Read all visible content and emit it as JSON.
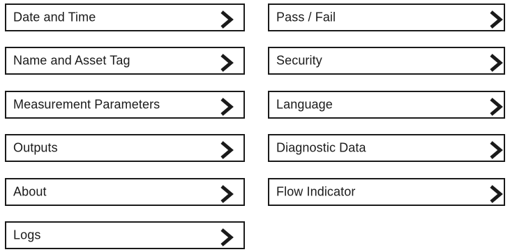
{
  "menu": {
    "left": [
      {
        "label": "Date and Time",
        "icon": "chevron-right-icon"
      },
      {
        "label": "Name and Asset Tag",
        "icon": "chevron-right-icon"
      },
      {
        "label": "Measurement Parameters",
        "icon": "chevron-right-icon"
      },
      {
        "label": "Outputs",
        "icon": "chevron-right-icon"
      },
      {
        "label": "About",
        "icon": "chevron-right-icon"
      },
      {
        "label": "Logs",
        "icon": "chevron-right-icon"
      }
    ],
    "right": [
      {
        "label": "Pass / Fail",
        "icon": "chevron-right-icon"
      },
      {
        "label": "Security",
        "icon": "chevron-right-icon"
      },
      {
        "label": "Language",
        "icon": "chevron-right-icon"
      },
      {
        "label": "Diagnostic Data",
        "icon": "chevron-right-icon"
      },
      {
        "label": "Flow Indicator",
        "icon": "chevron-right-icon"
      }
    ]
  },
  "colors": {
    "border": "#1a1a1a",
    "text": "#1a1a1a",
    "background": "#ffffff"
  }
}
